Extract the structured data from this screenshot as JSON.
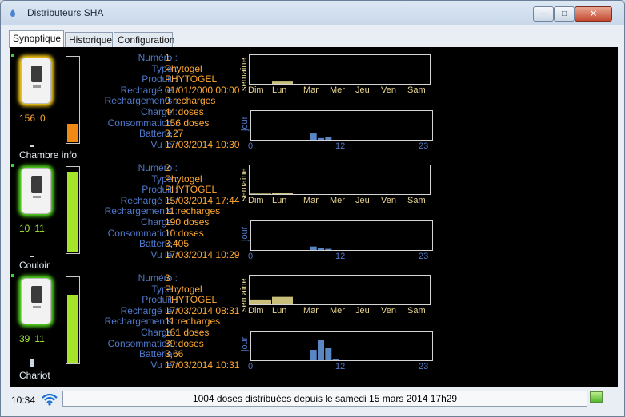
{
  "window": {
    "title": "Distributeurs SHA",
    "close_label": "✕",
    "min_label": "—",
    "max_label": "□"
  },
  "tabs": [
    {
      "label": "Synoptique",
      "active": true
    },
    {
      "label": "Historique",
      "active": false
    },
    {
      "label": "Configuration",
      "active": false
    }
  ],
  "field_labels": {
    "numero": "Numéro :",
    "type": "Type :",
    "produit": "Produit :",
    "recharge_le": "Rechargé le :",
    "rechargements": "Rechargements :",
    "charge": "Charge :",
    "consommation": "Consommation :",
    "batterie": "Batterie :",
    "vu_le": "Vu le :"
  },
  "chart_labels": {
    "week_axis": "semaine",
    "day_axis": "jour",
    "weekdays": [
      "Dim",
      "Lun",
      "Mar",
      "Mer",
      "Jeu",
      "Ven",
      "Sam"
    ],
    "hour_ticks": [
      "0",
      "12",
      "23"
    ]
  },
  "devices": [
    {
      "count_a": "156",
      "count_b": "0",
      "location": "Chambre info",
      "glow": "#ffd21a",
      "count_color": "#ffa833",
      "gauge_level": 0.22,
      "gauge_color": "#f08a14",
      "numero": "1",
      "type": "Phytogel",
      "produit": "PHYTOGEL",
      "recharge_le": "01/01/2000 00:00",
      "rechargements": "0 recharges",
      "charge": "44 doses",
      "consommation": "156 doses",
      "batterie": "3,27",
      "vu_le": "17/03/2014 10:30"
    },
    {
      "count_a": "10",
      "count_b": "11",
      "location": "Couloir",
      "glow": "#58e021",
      "count_color": "#a6ec3a",
      "gauge_level": 0.95,
      "gauge_color": "#a6e32b",
      "numero": "2",
      "type": "Phytogel",
      "produit": "PHYTOGEL",
      "recharge_le": "15/03/2014 17:44",
      "rechargements": "11 recharges",
      "charge": "190 doses",
      "consommation": "10 doses",
      "batterie": "3,405",
      "vu_le": "17/03/2014 10:29"
    },
    {
      "count_a": "39",
      "count_b": "11",
      "location": "Chariot",
      "glow": "#58e021",
      "count_color": "#a6ec3a",
      "gauge_level": 0.8,
      "gauge_color": "#a6e32b",
      "numero": "3",
      "type": "Phytogel",
      "produit": "PHYTOGEL",
      "recharge_le": "17/03/2014 08:31",
      "rechargements": "11 recharges",
      "charge": "161 doses",
      "consommation": "39 doses",
      "batterie": "3,66",
      "vu_le": "17/03/2014 10:31"
    }
  ],
  "chart_data": [
    {
      "type": "bar",
      "axis": "semaine",
      "device": "1",
      "categories": [
        "Dim",
        "Lun",
        "Mar",
        "Mer",
        "Jeu",
        "Ven",
        "Sam"
      ],
      "values": [
        0,
        0.08,
        0,
        0,
        0,
        0,
        0
      ],
      "color": "#c8c07a"
    },
    {
      "type": "bar",
      "axis": "jour",
      "device": "1",
      "x_ticks": [
        "0",
        "12",
        "23"
      ],
      "hours": [
        9,
        10,
        11
      ],
      "values": [
        0.22,
        0.06,
        0.1
      ],
      "color": "#5b86c4"
    },
    {
      "type": "bar",
      "axis": "semaine",
      "device": "2",
      "categories": [
        "Dim",
        "Lun",
        "Mar",
        "Mer",
        "Jeu",
        "Ven",
        "Sam"
      ],
      "values": [
        0.02,
        0.04,
        0,
        0,
        0,
        0,
        0
      ],
      "color": "#c8c07a"
    },
    {
      "type": "bar",
      "axis": "jour",
      "device": "2",
      "x_ticks": [
        "0",
        "12",
        "23"
      ],
      "hours": [
        9,
        10,
        11
      ],
      "values": [
        0.12,
        0.06,
        0.04
      ],
      "color": "#5b86c4"
    },
    {
      "type": "bar",
      "axis": "semaine",
      "device": "3",
      "categories": [
        "Dim",
        "Lun",
        "Mar",
        "Mer",
        "Jeu",
        "Ven",
        "Sam"
      ],
      "values": [
        0.17,
        0.26,
        0,
        0,
        0,
        0,
        0
      ],
      "color": "#c8c07a"
    },
    {
      "type": "bar",
      "axis": "jour",
      "device": "3",
      "x_ticks": [
        "0",
        "12",
        "23"
      ],
      "hours": [
        9,
        10,
        11,
        12
      ],
      "values": [
        0.36,
        0.71,
        0.44,
        0.04
      ],
      "color": "#5b86c4"
    }
  ],
  "status": {
    "time": "10:34",
    "message": "1004 doses distribuées depuis le samedi 15 mars 2014 17h29"
  }
}
